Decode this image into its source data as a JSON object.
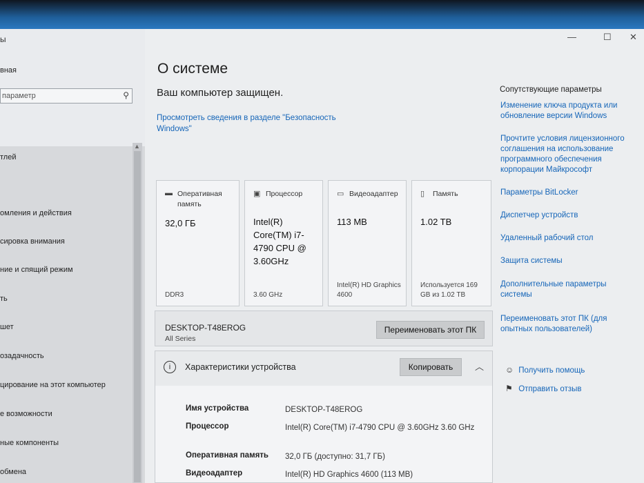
{
  "left_window": {
    "title": "ы",
    "home": "вная",
    "search_placeholder": "параметр",
    "items": [
      "тлей",
      "омления и действия",
      "сировка внимания",
      "ние и спящий режим",
      "ть",
      "шет",
      "озадачность",
      "цирование на этот компьютер",
      "е возможности",
      "ные компоненты",
      "обмена"
    ]
  },
  "window_controls": {
    "minimize": "—",
    "maximize": "☐",
    "close": "✕"
  },
  "page_title": "О системе",
  "protection_status": "Ваш компьютер защищен.",
  "security_link": "Просмотреть сведения в разделе \"Безопасность Windows\"",
  "tiles": [
    {
      "icon": "ram-icon",
      "label": "Оперативная память",
      "value": "32,0 ГБ",
      "sub": "DDR3"
    },
    {
      "icon": "cpu-icon",
      "label": "Процессор",
      "value": "Intel(R) Core(TM) i7-4790 CPU @ 3.60GHz",
      "sub": "3.60 GHz"
    },
    {
      "icon": "gpu-icon",
      "label": "Видеоадаптер",
      "value": "113 MB",
      "sub": "Intel(R) HD Graphics 4600"
    },
    {
      "icon": "storage-icon",
      "label": "Память",
      "value": "1.02 TB",
      "sub": "Используется 169 GB из 1.02 TB"
    }
  ],
  "pc": {
    "name": "DESKTOP-T48EROG",
    "series": "All Series",
    "rename_button": "Переименовать этот ПК"
  },
  "spec": {
    "title": "Характеристики устройства",
    "copy_button": "Копировать",
    "rows": [
      {
        "key": "Имя устройства",
        "value": "DESKTOP-T48EROG"
      },
      {
        "key": "Процессор",
        "value": "Intel(R) Core(TM) i7-4790 CPU @ 3.60GHz   3.60 GHz"
      },
      {
        "key": "Оперативная память",
        "value": "32,0 ГБ (доступно: 31,7 ГБ)"
      },
      {
        "key": "Видеоадаптер",
        "value": "Intel(R) HD Graphics 4600 (113 MB)"
      }
    ]
  },
  "related": {
    "heading": "Сопутствующие параметры",
    "links": [
      "Изменение ключа продукта или обновление версии Windows",
      "Прочтите условия лицензионного соглашения на использование программного обеспечения корпорации Майкрософт",
      "Параметры BitLocker",
      "Диспетчер устройств",
      "Удаленный рабочий стол",
      "Защита системы",
      "Дополнительные параметры системы",
      "Переименовать этот ПК (для опытных пользователей)"
    ],
    "help": "Получить помощь",
    "feedback": "Отправить отзыв"
  }
}
